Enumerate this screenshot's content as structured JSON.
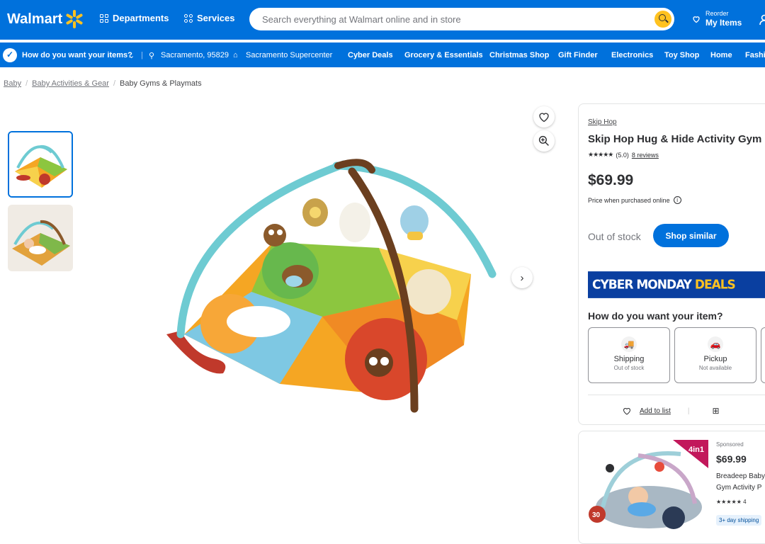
{
  "header": {
    "logo": "Walmart",
    "departments": "Departments",
    "services": "Services",
    "search_placeholder": "Search everything at Walmart online and in store",
    "reorder": "Reorder",
    "my_items": "My Items"
  },
  "subnav": {
    "question": "How do you want your items?",
    "location": "Sacramento, 95829",
    "store": "Sacramento Supercenter",
    "links": [
      "Cyber Deals",
      "Grocery & Essentials",
      "Christmas Shop",
      "Gift Finder",
      "Electronics",
      "Toy Shop",
      "Home",
      "Fashion"
    ]
  },
  "breadcrumb": [
    "Baby",
    "Baby Activities & Gear",
    "Baby Gyms & Playmats"
  ],
  "product": {
    "brand": "Skip Hop",
    "title": "Skip Hop Hug & Hide Activity Gym",
    "stars": "★★★★★",
    "rating": "(5.0)",
    "reviews": "8 reviews",
    "price": "$69.99",
    "price_note": "Price when purchased online",
    "stock": "Out of stock",
    "shop_similar": "Shop similar",
    "cyber_white": "CYBER MONDAY ",
    "cyber_yellow": "DEALS",
    "how_title": "How do you want your item?",
    "options": [
      {
        "label": "Shipping",
        "status": "Out of stock"
      },
      {
        "label": "Pickup",
        "status": "Not available"
      }
    ],
    "add_to_list": "Add to list"
  },
  "sponsored": {
    "label": "Sponsored",
    "price": "$69.99",
    "name": "Breadeep Baby Gym Activity P",
    "stars": "★★★★★",
    "review_count": "4",
    "shipping": "3+ day shipping",
    "badge": "4in1",
    "badge_count": "30"
  }
}
